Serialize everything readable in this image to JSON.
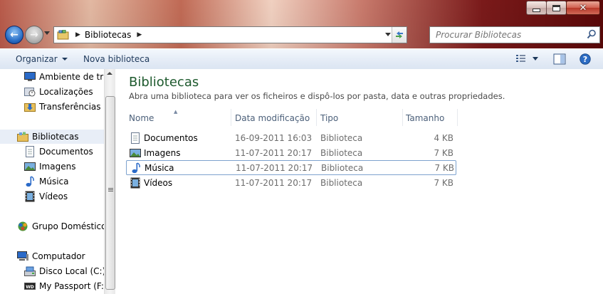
{
  "window": {
    "address_crumb": "Bibliotecas",
    "search_placeholder": "Procurar Bibliotecas"
  },
  "toolbar": {
    "organize_label": "Organizar",
    "new_library_label": "Nova biblioteca"
  },
  "nav_pane": {
    "favorites": [
      {
        "label": "Ambiente de trab",
        "icon": "desktop-icon"
      },
      {
        "label": "Localizações",
        "icon": "recent-places-icon"
      },
      {
        "label": "Transferências",
        "icon": "downloads-folder-icon"
      }
    ],
    "libraries_label": "Bibliotecas",
    "libraries": [
      {
        "label": "Documentos",
        "icon": "documents-icon"
      },
      {
        "label": "Imagens",
        "icon": "pictures-icon"
      },
      {
        "label": "Música",
        "icon": "music-icon"
      },
      {
        "label": "Vídeos",
        "icon": "videos-icon"
      }
    ],
    "homegroup_label": "Grupo Doméstico",
    "computer_label": "Computador",
    "drives": [
      {
        "label": "Disco Local (C:)",
        "icon": "local-disk-icon"
      },
      {
        "label": "My Passport (F:)",
        "icon": "external-drive-icon"
      }
    ]
  },
  "main": {
    "title": "Bibliotecas",
    "description": "Abra uma biblioteca para ver os ficheiros e dispô-los por pasta, data e outras propriedades.",
    "columns": [
      "Nome",
      "Data modificação",
      "Tipo",
      "Tamanho"
    ],
    "rows": [
      {
        "name": "Documentos",
        "date": "16-09-2011 16:03",
        "type": "Biblioteca",
        "size": "4 KB",
        "icon": "documents-icon"
      },
      {
        "name": "Imagens",
        "date": "11-07-2011 20:17",
        "type": "Biblioteca",
        "size": "7 KB",
        "icon": "pictures-icon"
      },
      {
        "name": "Música",
        "date": "11-07-2011 20:17",
        "type": "Biblioteca",
        "size": "7 KB",
        "icon": "music-icon"
      },
      {
        "name": "Vídeos",
        "date": "11-07-2011 20:17",
        "type": "Biblioteca",
        "size": "7 KB",
        "icon": "videos-icon"
      }
    ]
  }
}
